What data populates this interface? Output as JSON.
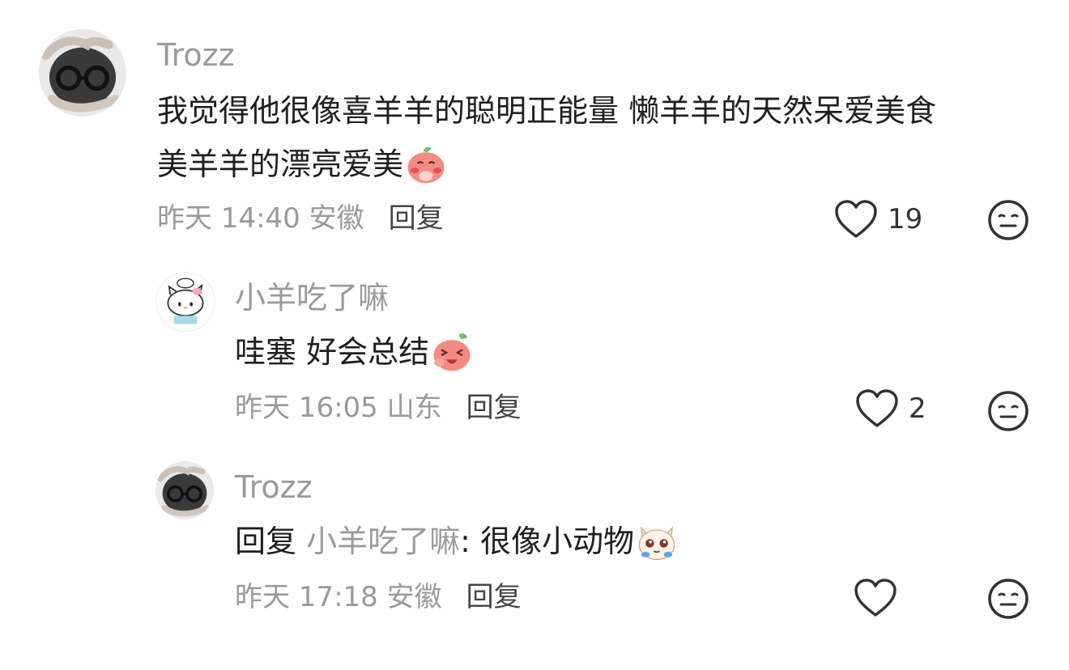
{
  "comments": [
    {
      "username": "Trozz",
      "text": "我觉得他很像喜羊羊的聪明正能量 懒羊羊的天然呆爱美食",
      "text_line2": "美羊羊的漂亮爱美",
      "emoji": "shy-peach-emoji",
      "meta": "昨天 14:40 安徽",
      "reply_label": "回复",
      "like_count": "19",
      "avatar": "glasses-hands-avatar"
    },
    {
      "username": "小羊吃了嘛",
      "text": "哇塞 好会总结",
      "emoji": "laughing-peach-emoji",
      "meta": "昨天 16:05 山东",
      "reply_label": "回复",
      "like_count": "2",
      "avatar": "hello-kitty-avatar"
    },
    {
      "username": "Trozz",
      "reply_prefix": "回复",
      "reply_target": "小羊吃了嘛",
      "text": ": 很像小动物",
      "emoji": "teary-cat-emoji",
      "meta": "昨天 17:18 安徽",
      "reply_label": "回复",
      "like_count": "",
      "avatar": "glasses-hands-avatar"
    }
  ],
  "colors": {
    "secondary_text": "#9a9a9a",
    "primary_text": "#1f1f1f",
    "icon_stroke": "#333333"
  }
}
